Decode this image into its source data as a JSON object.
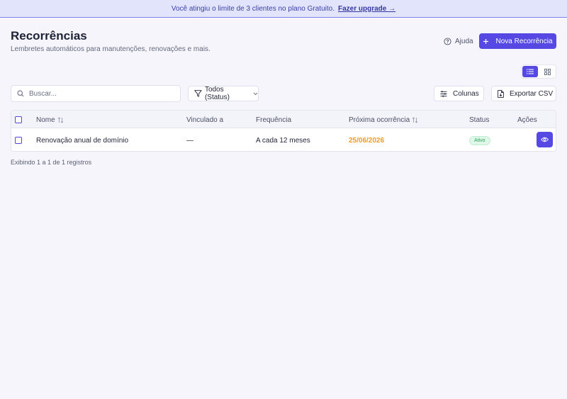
{
  "banner": {
    "message": "Você atingiu o limite de 3 clientes no plano Gratuito.",
    "link": "Fazer upgrade →"
  },
  "header": {
    "title": "Recorrências",
    "subtitle": "Lembretes automáticos para manutenções, renovações e mais.",
    "help_label": "Ajuda",
    "primary_label": "Nova Recorrência"
  },
  "view_toggle": {
    "options": [
      "list",
      "grid"
    ],
    "active": "list"
  },
  "toolbar": {
    "search_placeholder": "Buscar...",
    "status_filter": "Todos (Status)",
    "columns_label": "Colunas",
    "export_label": "Exportar CSV"
  },
  "table": {
    "columns": [
      "Nome",
      "Vinculado a",
      "Frequência",
      "Próxima ocorrência",
      "Status",
      "Ações"
    ],
    "rows": [
      {
        "name": "Renovação anual de domínio",
        "linked": "—",
        "frequency": "A cada 12 meses",
        "next": "25/06/2026",
        "status": "Ativo"
      }
    ]
  },
  "footer": {
    "records": "Exibindo 1 a 1 de 1 registros"
  },
  "colors": {
    "accent": "#5548e3",
    "warning_date": "#f39a1f",
    "status_active": "#26a55a",
    "banner_bg": "#e2e4fb"
  },
  "icons": {
    "help": "help-circle-icon",
    "plus": "plus-icon",
    "list_view": "list-icon",
    "grid_view": "grid-icon",
    "search": "search-icon",
    "filter": "filter-icon",
    "chevron": "chevron-down-icon",
    "columns": "sliders-icon",
    "export": "file-export-icon",
    "sort": "sort-icon",
    "view": "eye-icon"
  }
}
